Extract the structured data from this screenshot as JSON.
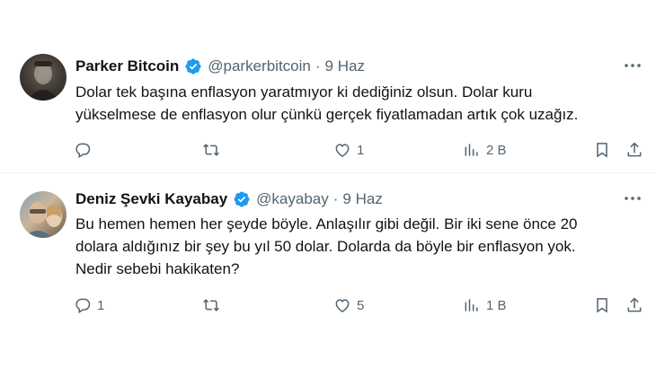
{
  "tweets": [
    {
      "author_name": "Parker Bitcoin",
      "handle": "@parkerbitcoin",
      "separator": "·",
      "date": "9 Haz",
      "text_lines": [
        "Dolar tek başına enflasyon yaratmıyor ki dediğiniz olsun. Dolar kuru",
        "yükselmese de enflasyon olur çünkü gerçek fiyatlamadan artık çok uzağız."
      ],
      "replies": "",
      "retweets": "",
      "likes": "1",
      "views": "2 B"
    },
    {
      "author_name": "Deniz Şevki Kayabay",
      "handle": "@kayabay",
      "separator": "·",
      "date": "9 Haz",
      "text_lines": [
        "Bu hemen hemen her şeyde böyle. Anlaşılır gibi değil. Bir iki sene önce 20",
        "dolara aldığınız bir şey bu yıl 50 dolar. Dolarda da böyle bir enflasyon yok.",
        "Nedir sebebi hakikaten?"
      ],
      "replies": "1",
      "retweets": "",
      "likes": "5",
      "views": "1 B"
    }
  ],
  "colors": {
    "verified_badge": "#1d9bf0",
    "secondary_text": "#536471",
    "primary_text": "#0f1419",
    "divider": "#eff3f4"
  },
  "icons": [
    "verified-badge-icon",
    "more-icon",
    "reply-icon",
    "retweet-icon",
    "like-icon",
    "views-icon",
    "bookmark-icon",
    "share-icon"
  ]
}
